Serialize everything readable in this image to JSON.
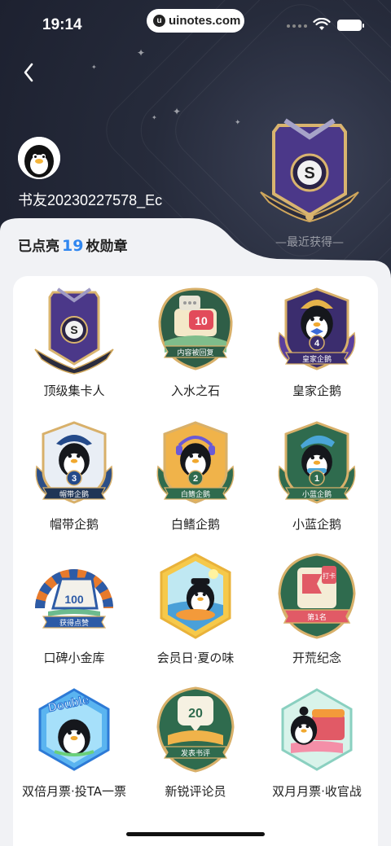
{
  "status_bar": {
    "time": "19:14",
    "url": "uinotes.com"
  },
  "profile": {
    "username": "书友20230227578_Ec"
  },
  "recent": {
    "label": "—最近获得—"
  },
  "summary": {
    "prefix": "已点亮",
    "count": "19",
    "suffix": "枚勋章"
  },
  "badges": [
    {
      "name": "顶级集卡人",
      "icon": "s-card-badge-icon",
      "ribbon": "",
      "num": ""
    },
    {
      "name": "入水之石",
      "icon": "reply-badge-icon",
      "ribbon": "内容被回复",
      "num": "10"
    },
    {
      "name": "皇家企鹅",
      "icon": "royal-penguin-badge-icon",
      "ribbon": "皇家企鹅",
      "num": "4"
    },
    {
      "name": "帽带企鹅",
      "icon": "hat-penguin-badge-icon",
      "ribbon": "帽带企鹅",
      "num": "3"
    },
    {
      "name": "白鳍企鹅",
      "icon": "white-fin-penguin-badge-icon",
      "ribbon": "白鳍企鹅",
      "num": "2"
    },
    {
      "name": "小蓝企鹅",
      "icon": "blue-penguin-badge-icon",
      "ribbon": "小蓝企鹅",
      "num": "1"
    },
    {
      "name": "口碑小金库",
      "icon": "likes-badge-icon",
      "ribbon": "获得点赞",
      "num": "100"
    },
    {
      "name": "会员日·夏の味",
      "icon": "summer-badge-icon",
      "ribbon": "",
      "num": ""
    },
    {
      "name": "开荒纪念",
      "icon": "first-checkin-badge-icon",
      "ribbon": "第1名",
      "num": "打卡"
    },
    {
      "name": "双倍月票·投TA一票",
      "icon": "double-badge-icon",
      "ribbon": "",
      "num": "Double"
    },
    {
      "name": "新锐评论员",
      "icon": "comment-badge-icon",
      "ribbon": "发表书评",
      "num": "20"
    },
    {
      "name": "双月月票·收官战",
      "icon": "chest-badge-icon",
      "ribbon": "",
      "num": ""
    }
  ],
  "colors": {
    "accent": "#2f86f0",
    "header_dark": "#1d2130",
    "purple": "#5a3f9c",
    "gold": "#d8b06a",
    "green": "#2f6b4e"
  }
}
